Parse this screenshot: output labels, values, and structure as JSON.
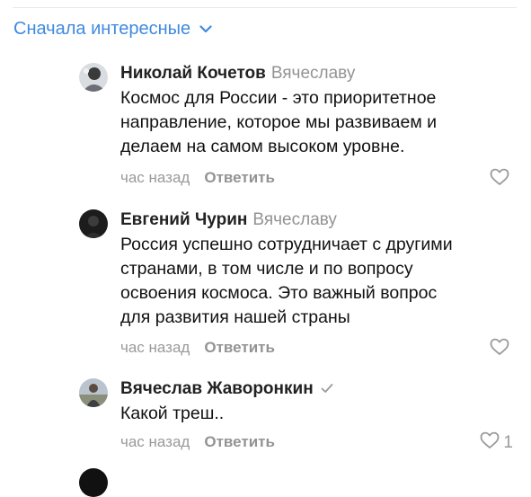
{
  "sort": {
    "label": "Сначала интересные",
    "icon": "chevron-down-icon"
  },
  "colors": {
    "accent": "#3f8ae0",
    "secondary": "#939393",
    "divider": "#e7e8ec"
  },
  "comments": [
    {
      "author": "Николай Кочетов",
      "reply_to": "Вячеславу",
      "text": "Космос для России - это приоритетное\nнаправление, которое мы развиваем и\nделаем на самом высоком уровне.",
      "time": "час назад",
      "reply_label": "Ответить",
      "likes": ""
    },
    {
      "author": "Евгений Чурин",
      "reply_to": "Вячеславу",
      "text": "Россия успешно сотрудничает с другими\nстранами, в том числе и по вопросу\nосвоения космоса. Это важный вопрос\nдля развития нашей страны",
      "time": "час назад",
      "reply_label": "Ответить",
      "likes": ""
    },
    {
      "author": "Вячеслав Жаворонкин",
      "reply_to": "",
      "verified_icon": "checkmark-icon",
      "text": "Какой треш..",
      "time": "час назад",
      "reply_label": "Ответить",
      "likes": "1"
    }
  ]
}
